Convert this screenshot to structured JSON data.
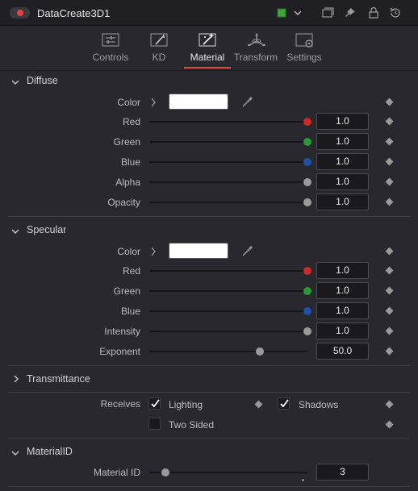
{
  "header": {
    "title": "DataCreate3D1",
    "color_chip": "#3fa33b"
  },
  "tabs": [
    {
      "label": "Controls",
      "icon": "sliders-icon"
    },
    {
      "label": "KD",
      "icon": "wand-icon"
    },
    {
      "label": "Material",
      "icon": "sparkle-wand-icon"
    },
    {
      "label": "Transform",
      "icon": "axes-icon"
    },
    {
      "label": "Settings",
      "icon": "gear-monitor-icon"
    }
  ],
  "active_tab": "Material",
  "diffuse": {
    "title": "Diffuse",
    "color_label": "Color",
    "swatch": "#ffffff",
    "rows": [
      {
        "label": "Red",
        "value": "1.0",
        "knob_color": "#cc2a22",
        "fraction": 1.0
      },
      {
        "label": "Green",
        "value": "1.0",
        "knob_color": "#2a9a35",
        "fraction": 1.0
      },
      {
        "label": "Blue",
        "value": "1.0",
        "knob_color": "#1f4fa6",
        "fraction": 1.0
      },
      {
        "label": "Alpha",
        "value": "1.0",
        "knob_color": "#9a9a9a",
        "fraction": 1.0
      },
      {
        "label": "Opacity",
        "value": "1.0",
        "knob_color": "#9a9a9a",
        "fraction": 1.0
      }
    ]
  },
  "specular": {
    "title": "Specular",
    "color_label": "Color",
    "swatch": "#ffffff",
    "rows": [
      {
        "label": "Red",
        "value": "1.0",
        "knob_color": "#cc2a22",
        "fraction": 1.0
      },
      {
        "label": "Green",
        "value": "1.0",
        "knob_color": "#2a9a35",
        "fraction": 1.0
      },
      {
        "label": "Blue",
        "value": "1.0",
        "knob_color": "#1f4fa6",
        "fraction": 1.0
      },
      {
        "label": "Intensity",
        "value": "1.0",
        "knob_color": "#9a9a9a",
        "fraction": 1.0
      },
      {
        "label": "Exponent",
        "value": "50.0",
        "knob_color": "#9a9a9a",
        "fraction": 0.7
      }
    ]
  },
  "transmittance": {
    "title": "Transmittance"
  },
  "receives": {
    "label": "Receives",
    "lighting": {
      "label": "Lighting",
      "checked": true
    },
    "shadows": {
      "label": "Shadows",
      "checked": true
    },
    "two_sided": {
      "label": "Two Sided",
      "checked": false
    }
  },
  "material_id": {
    "title": "MaterialID",
    "label": "Material ID",
    "value": "3",
    "knob_color": "#9a9a9a",
    "fraction": 0.1
  }
}
